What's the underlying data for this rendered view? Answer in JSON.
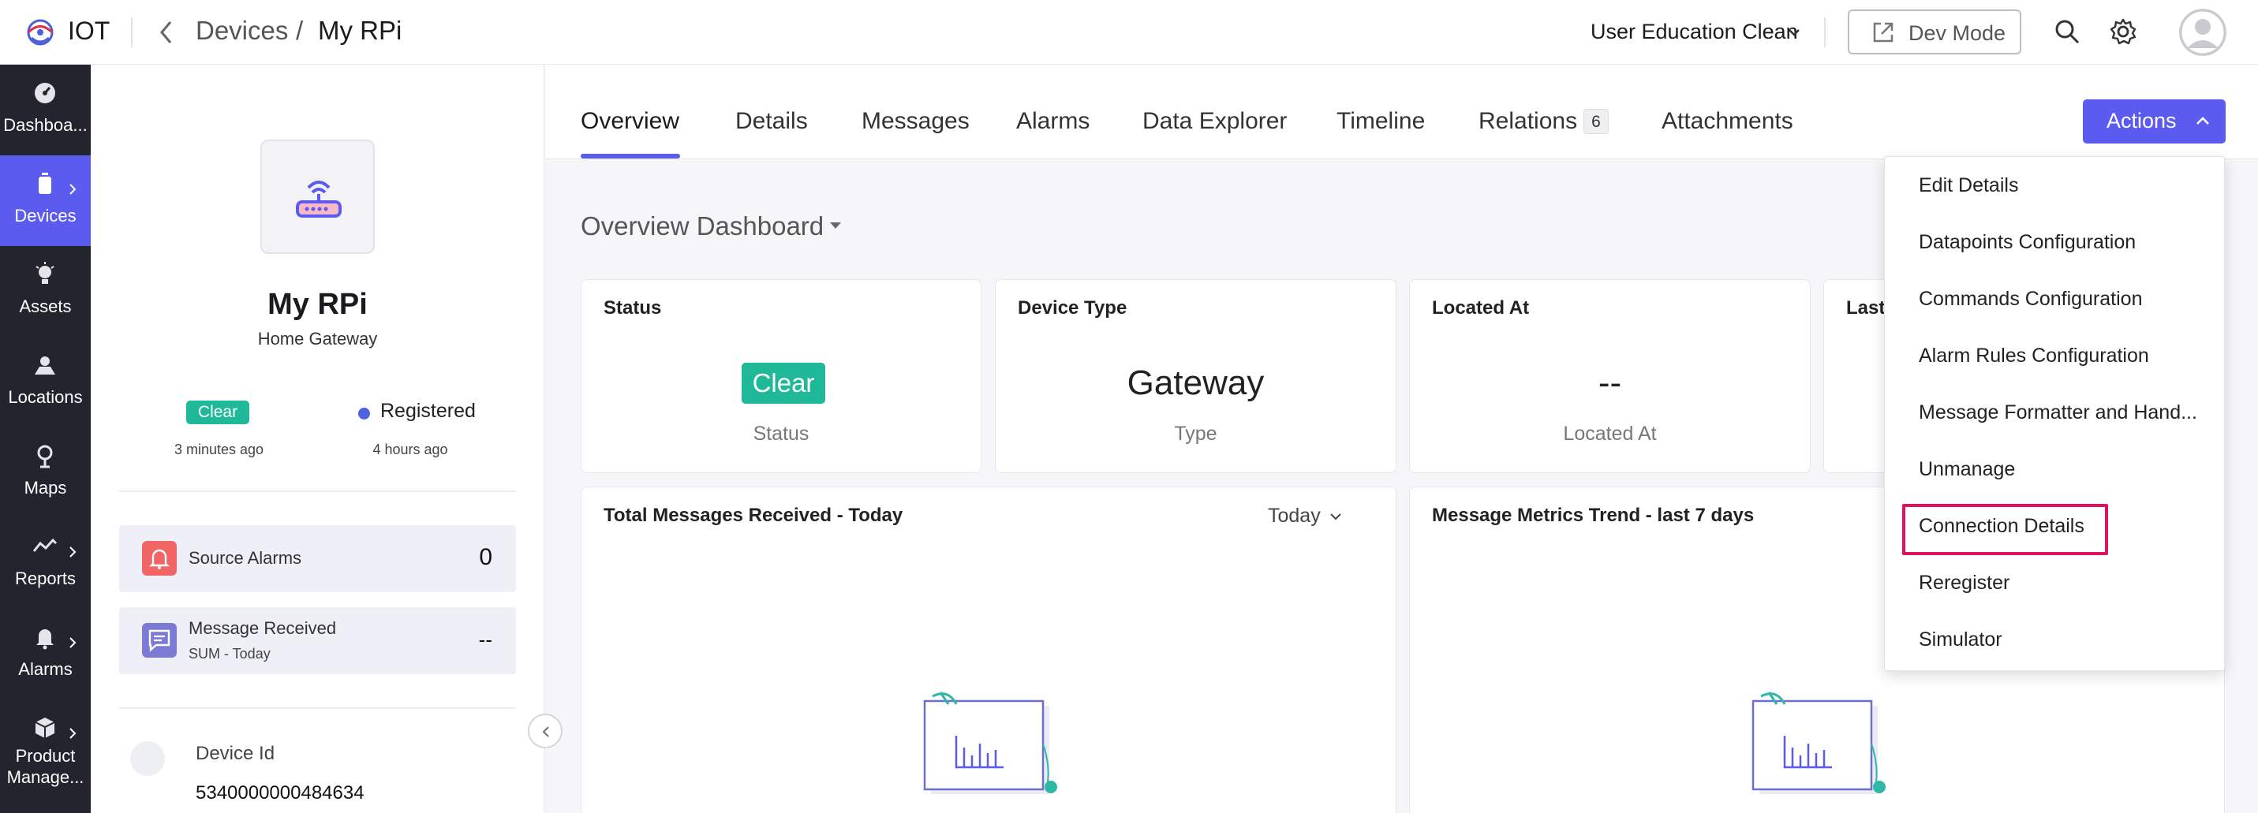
{
  "app": {
    "name": "IOT"
  },
  "breadcrumb": {
    "parent": "Devices",
    "separator": "/",
    "current": "My RPi"
  },
  "header": {
    "org": "User Education Clean",
    "dev_mode_label": "Dev Mode"
  },
  "nav": {
    "items": [
      {
        "label": "Dashboa...",
        "icon": "dashboard-icon"
      },
      {
        "label": "Devices",
        "icon": "device-icon",
        "active": true
      },
      {
        "label": "Assets",
        "icon": "asset-icon"
      },
      {
        "label": "Locations",
        "icon": "location-icon"
      },
      {
        "label": "Maps",
        "icon": "map-pin-icon"
      },
      {
        "label": "Reports",
        "icon": "reports-icon"
      },
      {
        "label": "Alarms",
        "icon": "bell-icon"
      },
      {
        "label": "Product Manage...",
        "icon": "box-icon"
      }
    ]
  },
  "device": {
    "name": "My RPi",
    "type": "Home Gateway",
    "status_badge": "Clear",
    "status_time": "3 minutes ago",
    "registration": "Registered",
    "registration_time": "4 hours ago",
    "source_alarms_label": "Source Alarms",
    "source_alarms_value": "0",
    "messages_label": "Message Received",
    "messages_sub": "SUM - Today",
    "messages_value": "--",
    "id_label": "Device Id",
    "id_value": "5340000000484634"
  },
  "tabs": [
    {
      "label": "Overview",
      "active": true
    },
    {
      "label": "Details"
    },
    {
      "label": "Messages"
    },
    {
      "label": "Alarms"
    },
    {
      "label": "Data Explorer"
    },
    {
      "label": "Timeline"
    },
    {
      "label": "Relations",
      "badge": "6"
    },
    {
      "label": "Attachments"
    }
  ],
  "actions_label": "Actions",
  "dashboard": {
    "title": "Overview Dashboard",
    "cards": {
      "status": {
        "title": "Status",
        "value": "Clear",
        "label": "Status"
      },
      "device_type": {
        "title": "Device Type",
        "value": "Gateway",
        "label": "Type"
      },
      "located_at": {
        "title": "Located At",
        "value": "--",
        "label": "Located At"
      },
      "last": {
        "title": "Last"
      }
    },
    "messages_card": {
      "title": "Total Messages Received - Today",
      "range": "Today"
    },
    "metrics_card": {
      "title": "Message Metrics Trend - last 7 days"
    }
  },
  "actions_menu": {
    "items": [
      "Edit Details",
      "Datapoints Configuration",
      "Commands Configuration",
      "Alarm Rules Configuration",
      "Message Formatter and Hand...",
      "Unmanage",
      "Connection Details",
      "Reregister",
      "Simulator"
    ],
    "highlighted": "Connection Details"
  },
  "colors": {
    "accent": "#5b5bf0",
    "status_clear": "#1fb899",
    "nav_bg": "#22252e",
    "highlight": "#e0115f"
  }
}
